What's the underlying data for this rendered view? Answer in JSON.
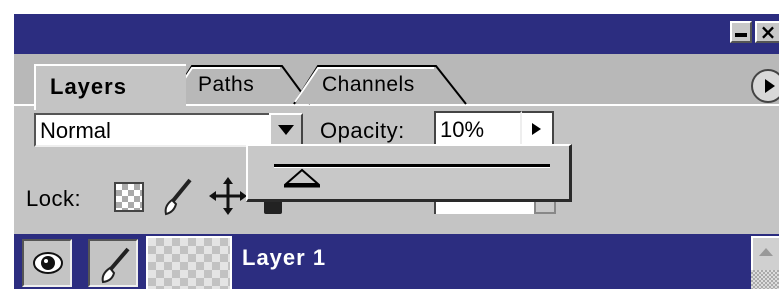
{
  "panel": {
    "tabs": [
      {
        "label": "Layers",
        "active": true
      },
      {
        "label": "Paths",
        "active": false
      },
      {
        "label": "Channels",
        "active": false
      }
    ],
    "title_bar_color": "#2c2d80"
  },
  "blend_mode": {
    "value": "Normal"
  },
  "opacity": {
    "label": "Opacity:",
    "value": "10%",
    "slider_level_percent": 10
  },
  "lock": {
    "label": "Lock:",
    "icons": [
      "transparency-lock-icon",
      "brush-lock-icon",
      "move-lock-icon",
      "padlock-icon"
    ]
  },
  "layers": [
    {
      "name": "Layer 1",
      "selected": true,
      "visible": true
    }
  ],
  "colors": {
    "panel": "#c4c4c4",
    "selection": "#2c2d80"
  }
}
